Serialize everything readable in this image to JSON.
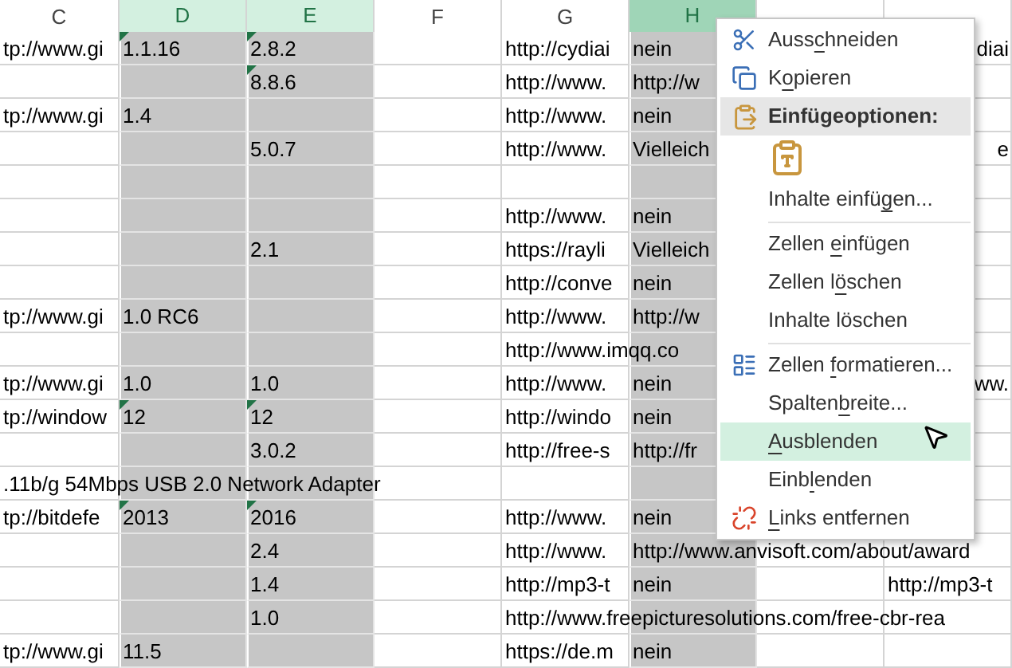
{
  "columns": [
    {
      "label": "C",
      "selected": false,
      "active": false
    },
    {
      "label": "D",
      "selected": true,
      "active": false
    },
    {
      "label": "E",
      "selected": true,
      "active": false
    },
    {
      "label": "F",
      "selected": false,
      "active": false
    },
    {
      "label": "G",
      "selected": false,
      "active": false
    },
    {
      "label": "H",
      "selected": true,
      "active": true
    },
    {
      "selected": false,
      "active": false
    },
    {
      "selected": false,
      "active": false
    }
  ],
  "rows": [
    {
      "cells": [
        {
          "text": "tp://www.gi"
        },
        {
          "text": "1.1.16",
          "comment": true
        },
        {
          "text": "2.8.2",
          "comment": true
        },
        null,
        {
          "text": "http://cydiai"
        },
        {
          "text": "nein"
        },
        null,
        {
          "text": "diai",
          "partly_hidden": true
        }
      ]
    },
    {
      "cells": [
        null,
        null,
        {
          "text": "8.8.6",
          "comment": true
        },
        null,
        {
          "text": "http://www."
        },
        {
          "text": "http://w"
        },
        null,
        null
      ]
    },
    {
      "cells": [
        {
          "text": "tp://www.gi"
        },
        {
          "text": "1.4"
        },
        null,
        null,
        {
          "text": "http://www."
        },
        {
          "text": "nein"
        },
        null,
        null
      ]
    },
    {
      "cells": [
        null,
        null,
        {
          "text": "5.0.7"
        },
        null,
        {
          "text": "http://www."
        },
        {
          "text": "Vielleich"
        },
        null,
        {
          "text": "e",
          "partly_hidden": true
        }
      ]
    },
    {
      "cells": [
        null,
        null,
        null,
        null,
        null,
        null,
        null,
        null
      ]
    },
    {
      "cells": [
        null,
        null,
        null,
        null,
        {
          "text": "http://www."
        },
        {
          "text": "nein"
        },
        null,
        null
      ]
    },
    {
      "cells": [
        null,
        null,
        {
          "text": "2.1"
        },
        null,
        {
          "text": "https://rayli"
        },
        {
          "text": "Vielleich"
        },
        null,
        null
      ]
    },
    {
      "cells": [
        null,
        null,
        null,
        null,
        {
          "text": "http://conve"
        },
        {
          "text": "nein"
        },
        null,
        null
      ]
    },
    {
      "cells": [
        {
          "text": "tp://www.gi"
        },
        {
          "text": "1.0 RC6"
        },
        null,
        null,
        {
          "text": "http://www."
        },
        {
          "text": "http://w"
        },
        null,
        null
      ]
    },
    {
      "cells": [
        null,
        null,
        null,
        null,
        {
          "text": "http://www.imqq.co"
        },
        null,
        null,
        null
      ]
    },
    {
      "cells": [
        {
          "text": "tp://www.gi"
        },
        {
          "text": "1.0"
        },
        {
          "text": "1.0"
        },
        null,
        {
          "text": "http://www."
        },
        {
          "text": "nein"
        },
        null,
        {
          "text": "ww.",
          "partly_hidden": true
        }
      ]
    },
    {
      "cells": [
        {
          "text": "tp://window"
        },
        {
          "text": "12",
          "comment": true
        },
        {
          "text": "12",
          "comment": true
        },
        null,
        {
          "text": "http://windo"
        },
        {
          "text": "nein"
        },
        null,
        null
      ]
    },
    {
      "cells": [
        null,
        null,
        {
          "text": "3.0.2"
        },
        null,
        {
          "text": "http://free-s"
        },
        {
          "text": "http://fr"
        },
        null,
        null
      ]
    },
    {
      "cells": [
        {
          "text": ".11b/g 54Mbps USB 2.0 Network Adapter"
        },
        null,
        null,
        null,
        null,
        null,
        null,
        null
      ]
    },
    {
      "cells": [
        {
          "text": "tp://bitdefe"
        },
        {
          "text": "2013",
          "comment": true
        },
        {
          "text": "2016",
          "comment": true
        },
        null,
        {
          "text": "http://www."
        },
        {
          "text": "nein"
        },
        null,
        null
      ]
    },
    {
      "cells": [
        null,
        null,
        {
          "text": "2.4"
        },
        null,
        {
          "text": "http://www."
        },
        {
          "text": "http://www.anvisoft.com/about/award"
        },
        null,
        null
      ]
    },
    {
      "cells": [
        null,
        null,
        {
          "text": "1.4"
        },
        null,
        {
          "text": "http://mp3-t"
        },
        {
          "text": "nein"
        },
        null,
        {
          "text": "http://mp3-t"
        }
      ]
    },
    {
      "cells": [
        null,
        null,
        {
          "text": "1.0"
        },
        null,
        {
          "text": "http://www.freepicturesolutions.com/free-cbr-rea"
        },
        null,
        null,
        null
      ]
    },
    {
      "cells": [
        {
          "text": "tp://www.gi"
        },
        {
          "text": "11.5"
        },
        null,
        null,
        {
          "text": "https://de.m"
        },
        {
          "text": "nein"
        },
        null,
        null
      ]
    }
  ],
  "context_menu": [
    {
      "kind": "item",
      "selected": false,
      "parts": [
        {
          "text": "Auss",
          "underline": false
        },
        {
          "text": "c",
          "underline": true
        },
        {
          "text": "hneiden",
          "underline": false
        }
      ]
    },
    {
      "kind": "item",
      "selected": false,
      "parts": [
        {
          "text": "K",
          "underline": false
        },
        {
          "text": "o",
          "underline": true
        },
        {
          "text": "pieren",
          "underline": false
        }
      ]
    },
    {
      "kind": "header",
      "parts": [
        {
          "text": "Einfügeoptionen:",
          "underline": false
        }
      ]
    },
    {
      "kind": "paste-option"
    },
    {
      "kind": "item",
      "selected": false,
      "parts": [
        {
          "text": "Inhalte einfü",
          "underline": false
        },
        {
          "text": "g",
          "underline": true
        },
        {
          "text": "en...",
          "underline": false
        }
      ]
    },
    {
      "kind": "separator"
    },
    {
      "kind": "item",
      "selected": false,
      "parts": [
        {
          "text": "Zellen ",
          "underline": false
        },
        {
          "text": "e",
          "underline": true
        },
        {
          "text": "infügen",
          "underline": false
        }
      ]
    },
    {
      "kind": "item",
      "selected": false,
      "parts": [
        {
          "text": "Zellen l",
          "underline": false
        },
        {
          "text": "ö",
          "underline": true
        },
        {
          "text": "schen",
          "underline": false
        }
      ]
    },
    {
      "kind": "item",
      "selected": false,
      "parts": [
        {
          "text": "Inhalte löschen",
          "underline": false
        }
      ]
    },
    {
      "kind": "separator"
    },
    {
      "kind": "item",
      "selected": false,
      "parts": [
        {
          "text": "Zellen ",
          "underline": false
        },
        {
          "text": "f",
          "underline": true
        },
        {
          "text": "ormatieren...",
          "underline": false
        }
      ]
    },
    {
      "kind": "item",
      "selected": false,
      "parts": [
        {
          "text": "Spalten",
          "underline": false
        },
        {
          "text": "b",
          "underline": true
        },
        {
          "text": "reite...",
          "underline": false
        }
      ]
    },
    {
      "kind": "item",
      "selected": true,
      "parts": [
        {
          "text": "A",
          "underline": true
        },
        {
          "text": "usblenden",
          "underline": false
        }
      ]
    },
    {
      "kind": "item",
      "selected": false,
      "parts": [
        {
          "text": "Einb",
          "underline": false
        },
        {
          "text": "l",
          "underline": true
        },
        {
          "text": "enden",
          "underline": false
        }
      ]
    },
    {
      "kind": "item",
      "selected": false,
      "parts": [
        {
          "text": "L",
          "underline": true
        },
        {
          "text": "inks entfernen",
          "underline": false
        }
      ]
    }
  ]
}
